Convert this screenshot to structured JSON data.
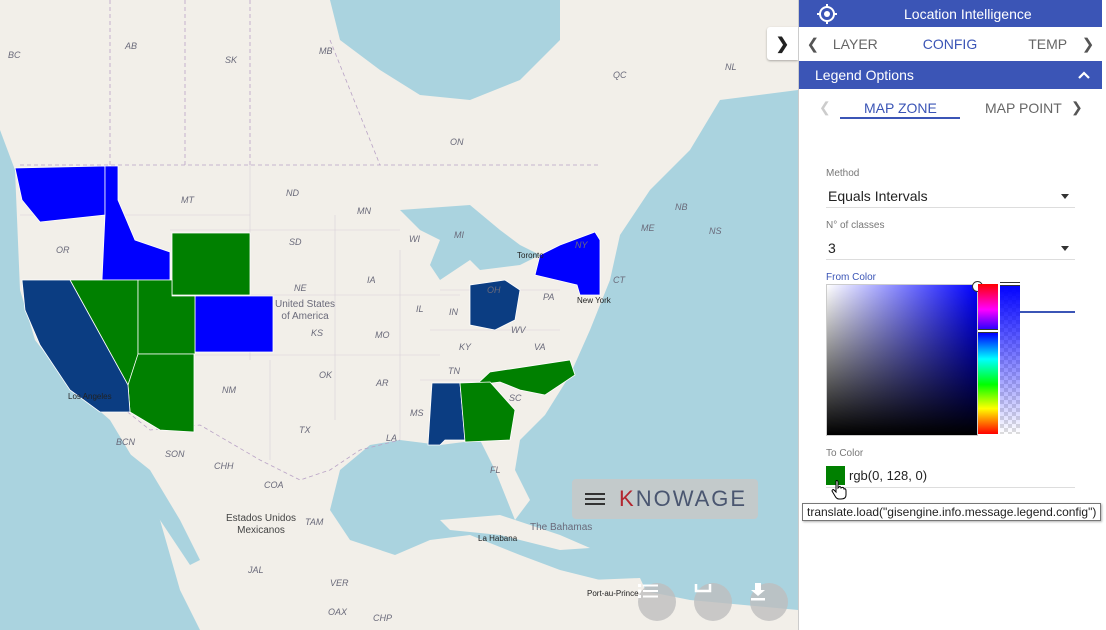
{
  "panel": {
    "title": "Location Intelligence",
    "tabs": [
      "LAYER",
      "CONFIG",
      "TEMP"
    ],
    "active_tab": "CONFIG",
    "section_title": "Legend Options",
    "subtabs": [
      "MAP ZONE",
      "MAP POINT"
    ],
    "active_subtab": "MAP ZONE",
    "method_label": "Method",
    "method_value": "Equals Intervals",
    "classes_label": "N° of classes",
    "classes_value": "3",
    "from_color_label": "From Color",
    "to_color_label": "To Color",
    "to_color_value": "rgb(0, 128, 0)",
    "tooltip": "translate.load(\"gisengine.info.message.legend.config\")"
  },
  "brand": {
    "logo": "KNOWAGE",
    "logo_k": "K",
    "logo_rest": "NOWAGE"
  },
  "colors": {
    "panel_blue": "#3b55b6",
    "zone_blue": "#0000ff",
    "zone_green": "#008000",
    "zone_navy": "#0b3d82",
    "to_color": "#008000",
    "picker_hue": "#0000ff"
  },
  "icons": {
    "panel": "map-target-icon",
    "expand": "chevron-right-icon",
    "collapse": "chevron-up-icon",
    "menu": "hamburger-icon",
    "list": "list-icon",
    "crop": "crop-icon",
    "download": "download-icon"
  },
  "map": {
    "state_labels": [
      "AB",
      "SK",
      "MB",
      "BC",
      "ON",
      "QC",
      "NL",
      "MT",
      "ND",
      "MN",
      "WI",
      "MI",
      "OR",
      "SD",
      "IA",
      "NE",
      "IL",
      "IN",
      "OH",
      "PA",
      "NY",
      "CT",
      "NB",
      "ME",
      "NS",
      "KS",
      "MO",
      "KY",
      "WV",
      "VA",
      "OK",
      "AR",
      "TN",
      "NM",
      "TX",
      "LA",
      "MS",
      "SC",
      "FL",
      "BCN",
      "SON",
      "CHH",
      "COA",
      "TAM",
      "JAL",
      "VER",
      "OAX",
      "CHP"
    ],
    "cities": [
      "Toronto",
      "New York",
      "Los Angeles",
      "La Habana",
      "Port-au-Prince"
    ],
    "country_usa": "United States\nof America",
    "country_mex": "Estados Unidos\nMexicanos",
    "bahamas": "The Bahamas"
  }
}
